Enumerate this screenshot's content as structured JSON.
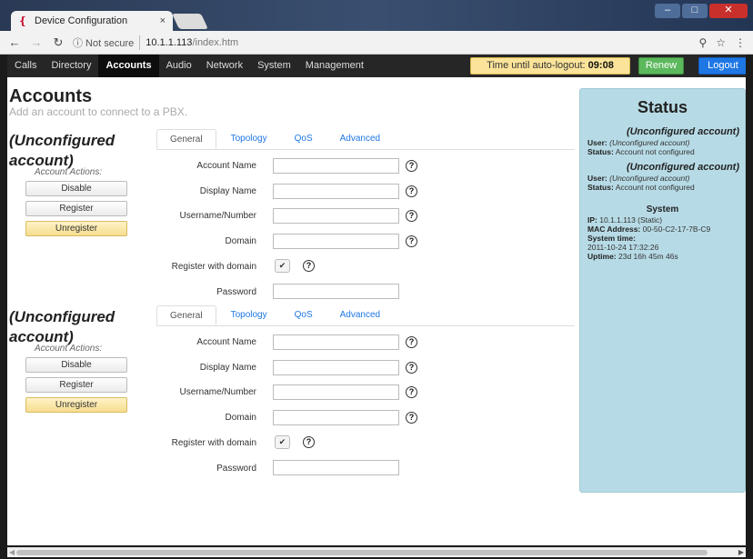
{
  "browser": {
    "tab_title": "Device Configuration",
    "tab_close": "×",
    "security": "ⓘ Not secure",
    "url_host": "10.1.1.113",
    "url_path": "/index.htm",
    "icons": [
      "back-icon",
      "forward-icon",
      "reload-icon",
      "info-icon",
      "key-icon",
      "star-icon",
      "menu-icon"
    ]
  },
  "menu": {
    "items": [
      "Calls",
      "Directory",
      "Accounts",
      "Audio",
      "Network",
      "System",
      "Management"
    ],
    "active": "Accounts",
    "timer_label": "Time until auto-logout:",
    "timer_value": "09:08",
    "renew": "Renew",
    "logout": "Logout"
  },
  "page": {
    "title": "Accounts",
    "subtitle": "Add an account to connect to a PBX."
  },
  "accounts": [
    {
      "title": "(Unconfigured account)",
      "actions_label": "Account Actions:",
      "buttons": [
        "Disable",
        "Register",
        "Unregister"
      ],
      "tabs": [
        "General",
        "Topology",
        "QoS",
        "Advanced"
      ],
      "fields": {
        "account_name": {
          "label": "Account Name",
          "value": ""
        },
        "display_name": {
          "label": "Display Name",
          "value": ""
        },
        "username": {
          "label": "Username/Number",
          "value": ""
        },
        "domain": {
          "label": "Domain",
          "value": ""
        },
        "register_with_domain": {
          "label": "Register with domain",
          "checked": true
        },
        "password": {
          "label": "Password",
          "value": ""
        }
      }
    },
    {
      "title": "(Unconfigured account)",
      "actions_label": "Account Actions:",
      "buttons": [
        "Disable",
        "Register",
        "Unregister"
      ],
      "tabs": [
        "General",
        "Topology",
        "QoS",
        "Advanced"
      ],
      "fields": {
        "account_name": {
          "label": "Account Name",
          "value": ""
        },
        "display_name": {
          "label": "Display Name",
          "value": ""
        },
        "username": {
          "label": "Username/Number",
          "value": ""
        },
        "domain": {
          "label": "Domain",
          "value": ""
        },
        "register_with_domain": {
          "label": "Register with domain",
          "checked": true
        },
        "password": {
          "label": "Password",
          "value": ""
        }
      }
    }
  ],
  "status": {
    "title": "Status",
    "accounts": [
      {
        "heading": "(Unconfigured account)",
        "user_label": "User:",
        "user_value": "(Unconfigured account)",
        "status_label": "Status:",
        "status_value": "Account not configured"
      },
      {
        "heading": "(Unconfigured account)",
        "user_label": "User:",
        "user_value": "(Unconfigured account)",
        "status_label": "Status:",
        "status_value": "Account not configured"
      }
    ],
    "system": {
      "heading": "System",
      "ip_label": "IP:",
      "ip_value": "10.1.1.113 (Static)",
      "mac_label": "MAC Address:",
      "mac_value": "00-50-C2-17-7B-C9",
      "time_label": "System time:",
      "time_value": "2011-10-24 17:32:26",
      "uptime_label": "Uptime:",
      "uptime_value": "23d 16h 45m 46s"
    }
  }
}
